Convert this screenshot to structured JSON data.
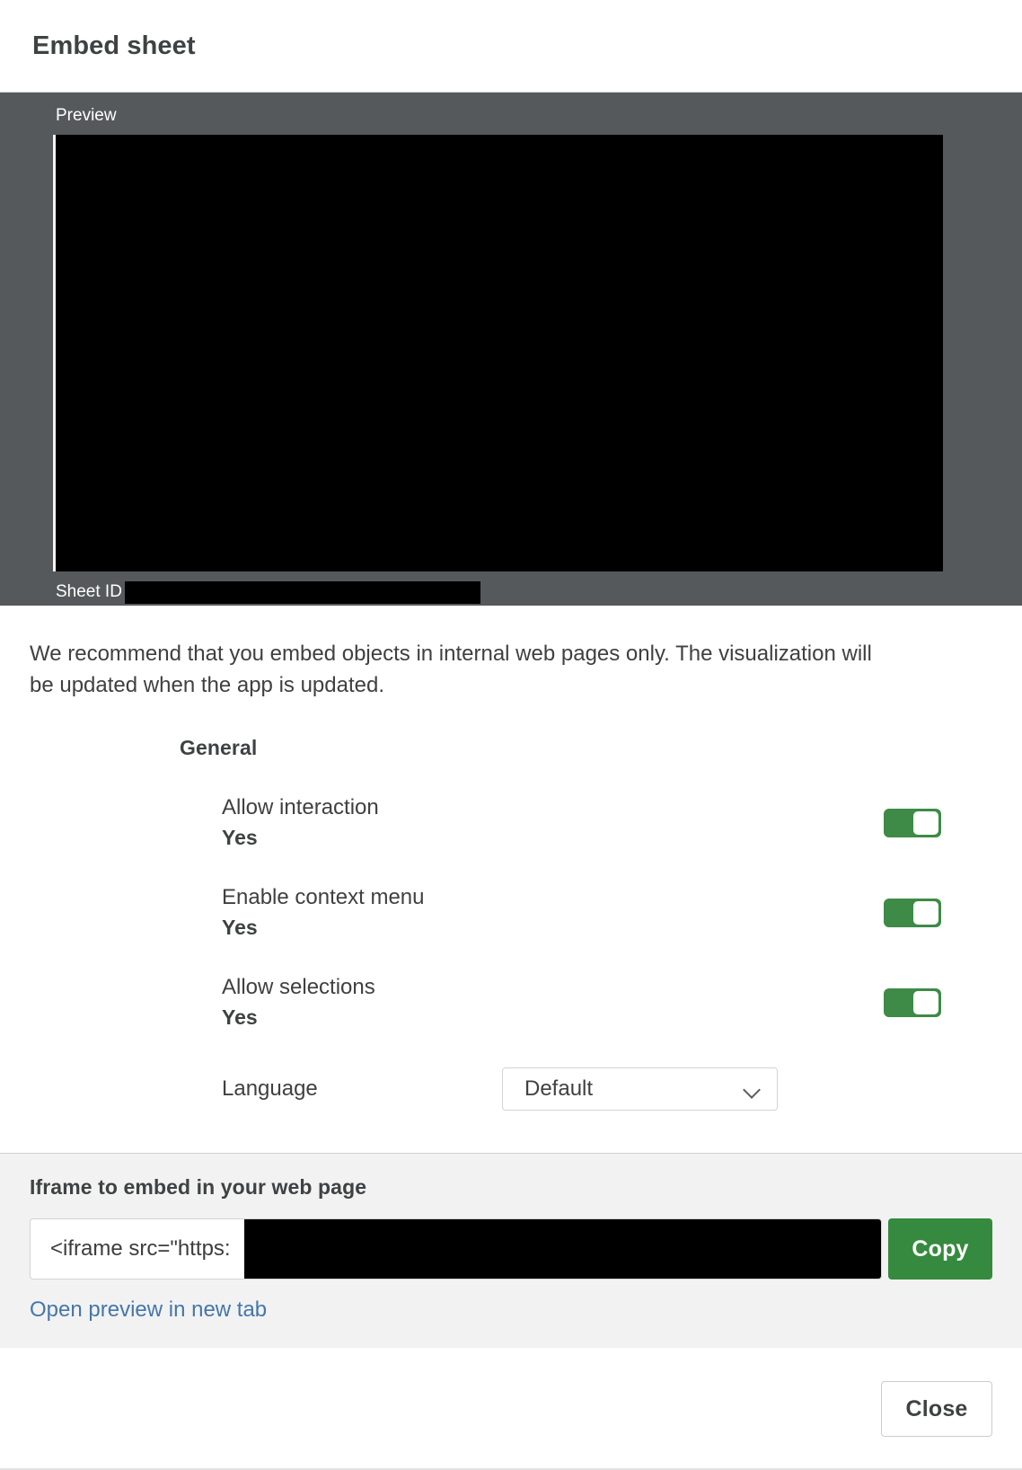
{
  "dialog": {
    "title": "Embed sheet"
  },
  "preview": {
    "label": "Preview",
    "sheet_id_label": "Sheet ID",
    "sheet_id_value": "",
    "panel_color": "#55595c"
  },
  "body": {
    "recommendation": "We recommend that you embed objects in internal web pages only. The visualization will be updated when the app is updated."
  },
  "settings": {
    "group_title": "General",
    "rows": [
      {
        "label": "Allow interaction",
        "value": "Yes",
        "toggle_on": true
      },
      {
        "label": "Enable context menu",
        "value": "Yes",
        "toggle_on": true
      },
      {
        "label": "Allow selections",
        "value": "Yes",
        "toggle_on": true
      }
    ],
    "language": {
      "label": "Language",
      "selected": "Default",
      "chevron_icon": "chevron-down-icon"
    },
    "toggle_on_color": "#3d8b46"
  },
  "iframe": {
    "heading": "Iframe to embed in your web page",
    "input_value": "<iframe src=\"https:",
    "copy_label": "Copy",
    "copy_color": "#368a3f",
    "open_preview_label": "Open preview in new tab",
    "link_color": "#4477aa"
  },
  "footer": {
    "close_label": "Close"
  }
}
